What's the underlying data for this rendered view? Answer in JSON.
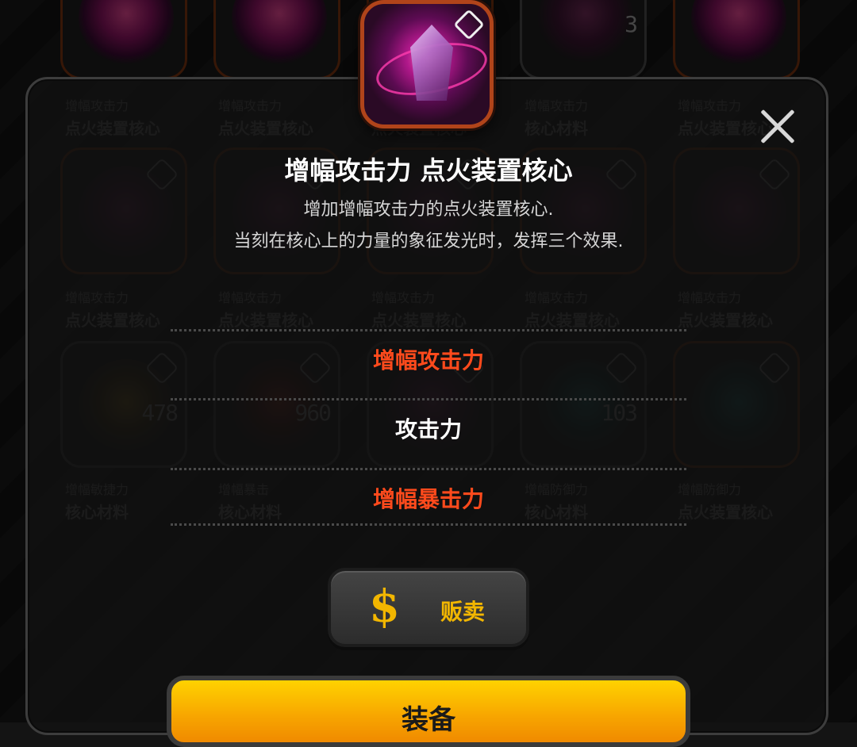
{
  "inventory": [
    {
      "sub": "增幅攻击力",
      "main": "点火装置核心",
      "gem": "gem-pink",
      "border": "orange",
      "count": ""
    },
    {
      "sub": "增幅攻击力",
      "main": "点火装置核心",
      "gem": "gem-pink",
      "border": "orange",
      "count": ""
    },
    {
      "sub": "增幅攻击力",
      "main": "点火装置核心",
      "gem": "gem-pink",
      "border": "orange",
      "count": ""
    },
    {
      "sub": "增幅攻击力",
      "main": "核心材料",
      "gem": "gem-dark",
      "border": "gray",
      "count": "3"
    },
    {
      "sub": "增幅攻击力",
      "main": "点火装置核心",
      "gem": "gem-pink",
      "border": "orange",
      "count": ""
    },
    {
      "sub": "增幅攻击力",
      "main": "点火装置核心",
      "gem": "gem-dark",
      "border": "orange",
      "count": ""
    },
    {
      "sub": "增幅攻击力",
      "main": "点火装置核心",
      "gem": "gem-dark",
      "border": "orange",
      "count": ""
    },
    {
      "sub": "增幅攻击力",
      "main": "点火装置核心",
      "gem": "gem-dark",
      "border": "orange",
      "count": ""
    },
    {
      "sub": "增幅攻击力",
      "main": "点火装置核心",
      "gem": "gem-dark",
      "border": "orange",
      "count": ""
    },
    {
      "sub": "增幅攻击力",
      "main": "点火装置核心",
      "gem": "gem-dark",
      "border": "orange",
      "count": ""
    },
    {
      "sub": "增幅敏捷力",
      "main": "核心材料",
      "gem": "gem-gold",
      "border": "gray",
      "count": "478"
    },
    {
      "sub": "增幅暴击",
      "main": "核心材料",
      "gem": "gem-red",
      "border": "gray",
      "count": "960"
    },
    {
      "sub": "",
      "main": "",
      "gem": "gem-dark",
      "border": "gray",
      "count": ""
    },
    {
      "sub": "增幅防御力",
      "main": "核心材料",
      "gem": "gem-teal",
      "border": "gray",
      "count": "103"
    },
    {
      "sub": "增幅防御力",
      "main": "点火装置核心",
      "gem": "gem-teal",
      "border": "orange",
      "count": ""
    }
  ],
  "item": {
    "title": "增幅攻击力 点火装置核心",
    "desc_line1": "增加增幅攻击力的点火装置核心.",
    "desc_line2": "当刻在核心上的力量的象征发光时，发挥三个效果.",
    "icon": "crystal-core-icon"
  },
  "effects": [
    {
      "label": "增幅攻击力",
      "color": "#ff4a1c"
    },
    {
      "label": "攻击力",
      "color": "#ffffff"
    },
    {
      "label": "增幅暴击力",
      "color": "#ff4a1c"
    }
  ],
  "buttons": {
    "sell_icon": "$",
    "sell_label": "贩卖",
    "equip_label": "装备"
  }
}
